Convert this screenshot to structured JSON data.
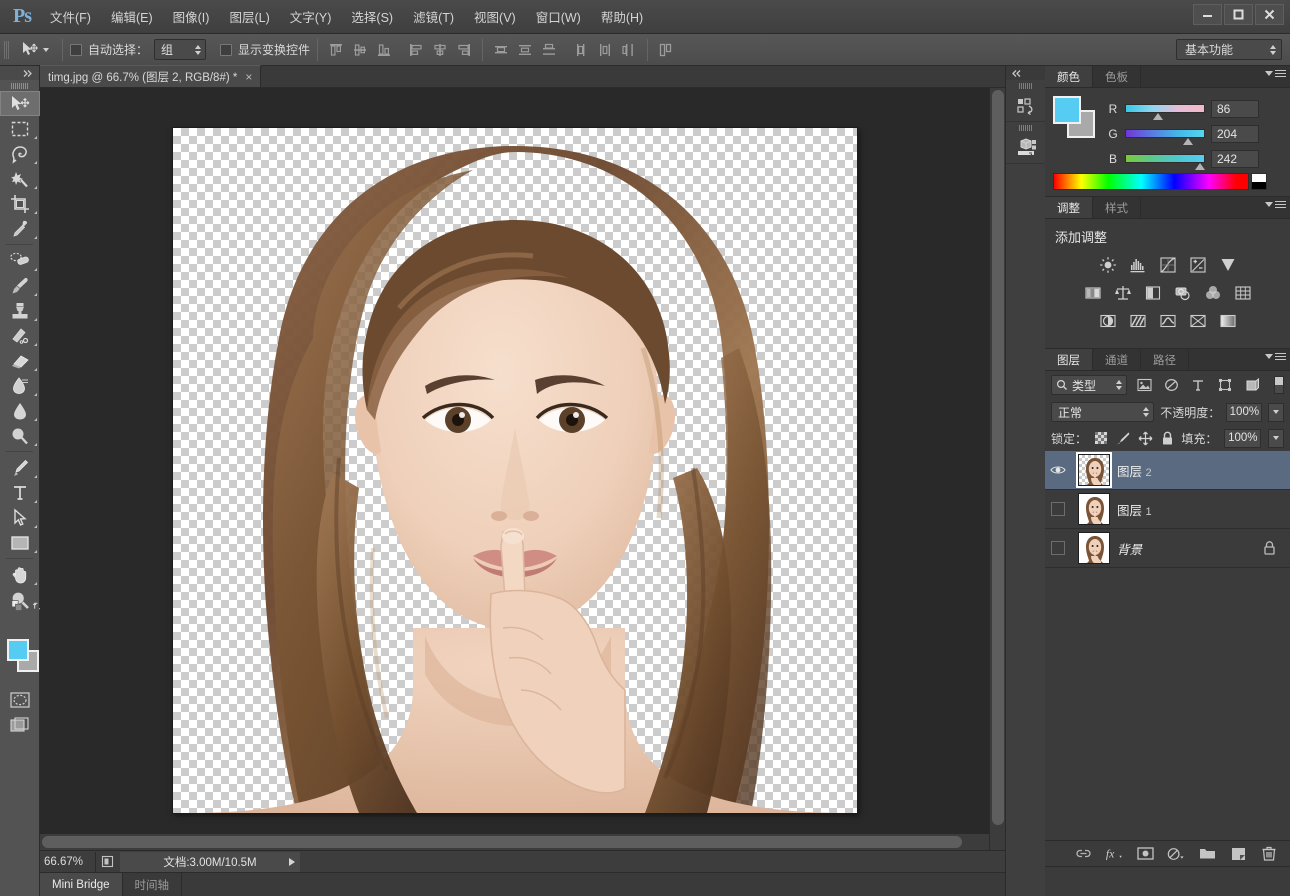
{
  "app": {
    "logo": "Ps",
    "menu": [
      "文件(F)",
      "编辑(E)",
      "图像(I)",
      "图层(L)",
      "文字(Y)",
      "选择(S)",
      "滤镜(T)",
      "视图(V)",
      "窗口(W)",
      "帮助(H)"
    ],
    "window_buttons": {
      "minimize": "minimize-icon",
      "maximize": "maximize-icon",
      "close": "close-icon"
    }
  },
  "options_bar": {
    "tool_icon": "move-tool-icon",
    "auto_select_label": "自动选择：",
    "auto_select_value": "组",
    "auto_select_checked": false,
    "show_transform_label": "显示变换控件",
    "show_transform_checked": false,
    "align_icons": [
      "align-top-edges-icon",
      "align-vertical-centers-icon",
      "align-bottom-edges-icon",
      "align-left-edges-icon",
      "align-horizontal-centers-icon",
      "align-right-edges-icon"
    ],
    "distribute_icons": [
      "distribute-top-edges-icon",
      "distribute-vertical-centers-icon",
      "distribute-bottom-edges-icon",
      "distribute-left-edges-icon",
      "distribute-horizontal-centers-icon",
      "distribute-right-edges-icon"
    ],
    "auto_align_icon": "auto-align-layers-icon",
    "workspace": "基本功能"
  },
  "toolbar": {
    "collapse_icon": "collapse-right-icon",
    "tools": [
      {
        "name": "move-tool",
        "selected": true,
        "has_flyout": false
      },
      {
        "name": "rectangular-marquee-tool",
        "selected": false,
        "has_flyout": true
      },
      {
        "name": "lasso-tool",
        "selected": false,
        "has_flyout": true
      },
      {
        "name": "magic-wand-tool",
        "selected": false,
        "has_flyout": true
      },
      {
        "name": "crop-tool",
        "selected": false,
        "has_flyout": true
      },
      {
        "name": "eyedropper-tool",
        "selected": false,
        "has_flyout": true
      },
      {
        "name": "spot-healing-brush-tool",
        "selected": false,
        "has_flyout": true
      },
      {
        "name": "brush-tool",
        "selected": false,
        "has_flyout": true
      },
      {
        "name": "clone-stamp-tool",
        "selected": false,
        "has_flyout": true
      },
      {
        "name": "history-brush-tool",
        "selected": false,
        "has_flyout": true
      },
      {
        "name": "eraser-tool",
        "selected": false,
        "has_flyout": true
      },
      {
        "name": "gradient-tool",
        "selected": false,
        "has_flyout": true
      },
      {
        "name": "blur-tool",
        "selected": false,
        "has_flyout": true
      },
      {
        "name": "dodge-tool",
        "selected": false,
        "has_flyout": true
      },
      {
        "name": "pen-tool",
        "selected": false,
        "has_flyout": true
      },
      {
        "name": "horizontal-type-tool",
        "selected": false,
        "has_flyout": true
      },
      {
        "name": "path-selection-tool",
        "selected": false,
        "has_flyout": true
      },
      {
        "name": "rectangle-tool",
        "selected": false,
        "has_flyout": true
      },
      {
        "name": "hand-tool",
        "selected": false,
        "has_flyout": true
      },
      {
        "name": "zoom-tool",
        "selected": false,
        "has_flyout": false
      }
    ],
    "foreground_color": "#56ccf2",
    "background_color": "#a9a9a9",
    "quick_mask_icon": "quick-mask-icon",
    "screen_mode_icon": "screen-mode-icon"
  },
  "document": {
    "tab_title": "timg.jpg @ 66.7% (图层 2, RGB/8#) *",
    "close_icon": "close-tab-icon"
  },
  "status_bar": {
    "zoom": "66.67%",
    "doc_icon": "document-thumb-icon",
    "doc_info": "文档:3.00M/10.5M",
    "expand_icon": "expand-arrow-icon"
  },
  "bottom_dock": {
    "tabs": [
      {
        "label": "Mini Bridge",
        "active": true
      },
      {
        "label": "时间轴",
        "active": false
      }
    ]
  },
  "rail": {
    "collapse_icon": "collapse-left-icon",
    "buttons": [
      "history-panel-icon",
      "3d-panel-icon"
    ]
  },
  "color_panel": {
    "tabs": [
      {
        "label": "颜色",
        "active": true
      },
      {
        "label": "色板",
        "active": false
      }
    ],
    "menu_icon": "panel-menu-icon",
    "foreground_color": "#56ccf2",
    "background_color": "#a9a9a9",
    "channels": [
      {
        "label": "R",
        "value": "86",
        "pos": 33
      },
      {
        "label": "G",
        "value": "204",
        "pos": 79
      },
      {
        "label": "B",
        "value": "242",
        "pos": 94
      }
    ],
    "spectrum_icon": "color-spectrum-ramp"
  },
  "adjustments_panel": {
    "tabs": [
      {
        "label": "调整",
        "active": true
      },
      {
        "label": "样式",
        "active": false
      }
    ],
    "menu_icon": "panel-menu-icon",
    "title": "添加调整",
    "rows": [
      [
        "brightness-contrast-icon",
        "levels-icon",
        "curves-icon",
        "exposure-icon",
        "vibrance-icon"
      ],
      [
        "hue-saturation-icon",
        "color-balance-icon",
        "black-white-icon",
        "photo-filter-icon",
        "channel-mixer-icon",
        "color-lookup-icon"
      ],
      [
        "invert-icon",
        "posterize-icon",
        "threshold-icon",
        "selective-color-icon",
        "gradient-map-icon"
      ]
    ]
  },
  "layers_panel": {
    "tabs": [
      {
        "label": "图层",
        "active": true
      },
      {
        "label": "通道",
        "active": false
      },
      {
        "label": "路径",
        "active": false
      }
    ],
    "menu_icon": "panel-menu-icon",
    "filter": {
      "search_icon": "search-icon",
      "type_label": "类型",
      "icons": [
        "filter-pixel-icon",
        "filter-adjustment-icon",
        "filter-type-icon",
        "filter-shape-icon",
        "filter-smart-object-icon"
      ],
      "toggle_icon": "filter-toggle-switch"
    },
    "blend_mode": "正常",
    "opacity_label": "不透明度：",
    "opacity_value": "100%",
    "lock_label": "锁定：",
    "lock_icons": [
      "lock-transparent-pixels-icon",
      "lock-image-pixels-icon",
      "lock-position-icon",
      "lock-all-icon"
    ],
    "fill_label": "填充：",
    "fill_value": "100%",
    "layers": [
      {
        "name": "图层",
        "num": "2",
        "visible": true,
        "selected": true,
        "locked": false,
        "transparent_thumb": true
      },
      {
        "name": "图层",
        "num": "1",
        "visible": false,
        "selected": false,
        "locked": false,
        "transparent_thumb": false
      },
      {
        "name": "背景",
        "num": "",
        "visible": false,
        "selected": false,
        "locked": true,
        "transparent_thumb": false
      }
    ],
    "bottom_icons": [
      "link-layers-icon",
      "layer-style-fx-icon",
      "add-layer-mask-icon",
      "new-adjustment-layer-icon",
      "new-group-icon",
      "new-layer-icon",
      "delete-layer-icon"
    ]
  },
  "canvas": {
    "transparency_checker": "checkerboard",
    "image_alt": "woman-portrait-shush-gesture"
  },
  "colors": {
    "accent": "#56ccf2",
    "selection": "#5a6a80",
    "panel_bg": "#3b3b3b",
    "canvas_bg": "#292929",
    "toolbar_bg": "#535353"
  }
}
